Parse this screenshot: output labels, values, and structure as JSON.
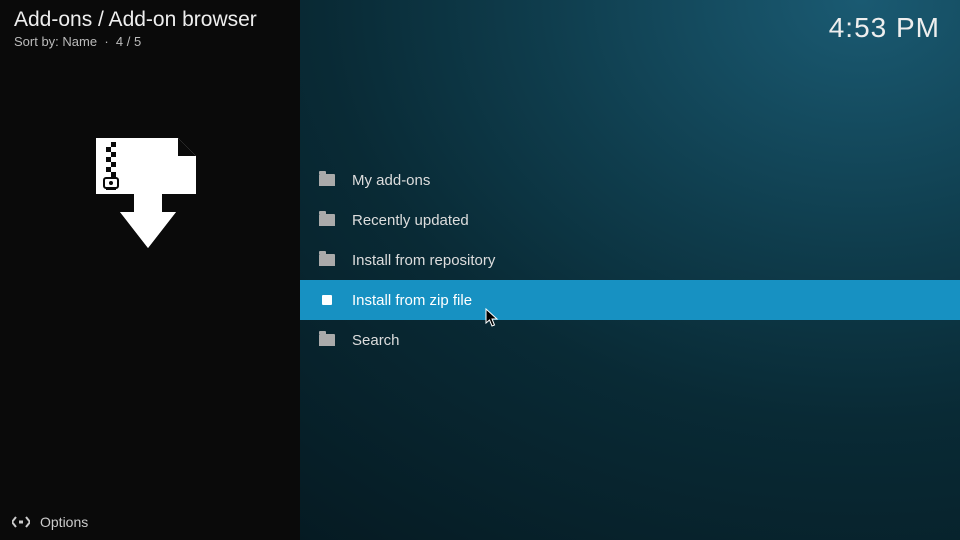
{
  "header": {
    "title": "Add-ons / Add-on browser",
    "sort_prefix": "Sort by:",
    "sort_value": "Name",
    "position": "4 / 5"
  },
  "clock": "4:53 PM",
  "list": {
    "items": [
      {
        "label": "My add-ons",
        "icon": "folder",
        "selected": false
      },
      {
        "label": "Recently updated",
        "icon": "folder",
        "selected": false
      },
      {
        "label": "Install from repository",
        "icon": "folder",
        "selected": false
      },
      {
        "label": "Install from zip file",
        "icon": "zip",
        "selected": true
      },
      {
        "label": "Search",
        "icon": "folder",
        "selected": false
      }
    ]
  },
  "footer": {
    "options_label": "Options"
  }
}
